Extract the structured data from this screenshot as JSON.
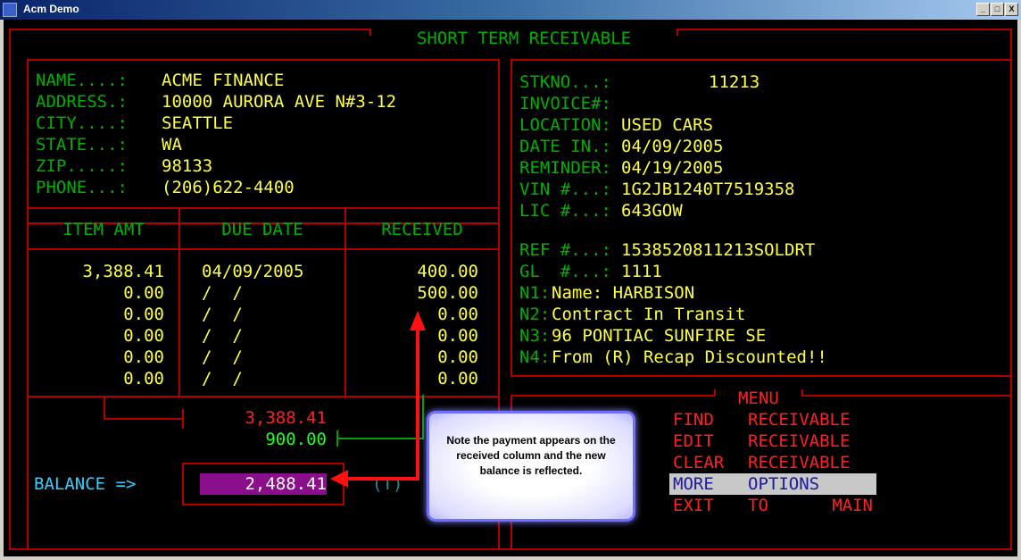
{
  "window": {
    "title": "Acm Demo",
    "min": "_",
    "max": "□",
    "close": "X"
  },
  "screen_title": "SHORT TERM RECEIVABLE",
  "customer": {
    "name_label": "NAME....:",
    "name": "ACME FINANCE",
    "address_label": "ADDRESS.:",
    "address": "10000 AURORA AVE N#3-12",
    "city_label": "CITY....:",
    "city": "SEATTLE",
    "state_label": "STATE...:",
    "state": "WA",
    "zip_label": "ZIP.....:",
    "zip": "98133",
    "phone_label": "PHONE...:",
    "phone": "(206)622-4400"
  },
  "table": {
    "headers": [
      "ITEM AMT",
      "DUE DATE",
      "RECEIVED"
    ],
    "rows": [
      [
        "3,388.41",
        "04/09/2005",
        "400.00"
      ],
      [
        "0.00",
        "/  /",
        "500.00"
      ],
      [
        "0.00",
        "/  /",
        "0.00"
      ],
      [
        "0.00",
        "/  /",
        "0.00"
      ],
      [
        "0.00",
        "/  /",
        "0.00"
      ],
      [
        "0.00",
        "/  /",
        "0.00"
      ]
    ]
  },
  "totals": {
    "item_total": "3,388.41",
    "received_total": "900.00",
    "balance_label": "BALANCE =>",
    "balance": "2,488.41",
    "t_marker": "(T)"
  },
  "details": {
    "stkno_label": "STKNO...:",
    "stkno": "11213",
    "invoice_label": "INVOICE#:",
    "invoice": "",
    "location_label": "LOCATION:",
    "location": "USED CARS",
    "date_in_label": "DATE IN.:",
    "date_in": "04/09/2005",
    "reminder_label": "REMINDER:",
    "reminder": "04/19/2005",
    "vin_label": "VIN #...:",
    "vin": "1G2JB1240T7519358",
    "lic_label": "LIC #...:",
    "lic": "643GOW",
    "ref_label": "REF #...:",
    "ref": "1538520811213SOLDRT",
    "gl_label": "GL  #...:",
    "gl": "1111",
    "n1_label": "N1:",
    "n1": "Name: HARBISON",
    "n2_label": "N2:",
    "n2": "Contract In Transit",
    "n3_label": "N3:",
    "n3": "96 PONTIAC SUNFIRE SE",
    "n4_label": "N4:",
    "n4": "From (R) Recap Discounted!!"
  },
  "menu": {
    "title": "MENU",
    "items": [
      {
        "verb": "FIND",
        "noun": "RECEIVABLE",
        "selected": false
      },
      {
        "verb": "EDIT",
        "noun": "RECEIVABLE",
        "selected": false
      },
      {
        "verb": "CLEAR",
        "noun": "RECEIVABLE",
        "selected": false
      },
      {
        "verb": "MORE",
        "noun": "OPTIONS",
        "selected": true
      },
      {
        "verb": "EXIT",
        "mid": "TO",
        "noun": "MAIN",
        "selected": false
      }
    ]
  },
  "callout": {
    "text": "Note the payment appears on the received column and the new balance is reflected."
  },
  "colors": {
    "frame": "#b00000",
    "label": "#00b000",
    "value": "#ffff40",
    "menu": "#ff2020",
    "balance_bg": "#8a0f8a",
    "callout_border": "#7070ff"
  }
}
